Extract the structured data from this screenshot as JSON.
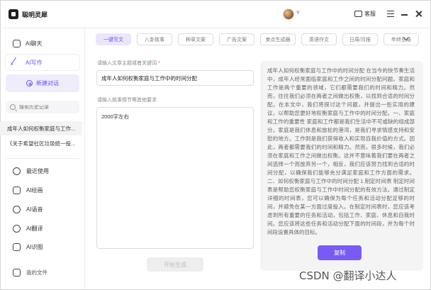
{
  "app": {
    "title": "聪明灵犀",
    "user_name": "Y",
    "service_label": "客服"
  },
  "sidebar": {
    "nav": [
      {
        "label": "AI聊天",
        "icon": "chat-icon"
      },
      {
        "label": "AI写作",
        "icon": "pen-icon"
      }
    ],
    "new_chat_label": "新建对话",
    "search_placeholder": "搜索历史记录",
    "history": [
      "成年人如何权衡家庭与工作...",
      "《关于希望社区垃圾统一投..."
    ],
    "tools": [
      {
        "label": "最近使用",
        "icon": "recent-icon"
      },
      {
        "label": "AI绘画",
        "icon": "paint-icon"
      },
      {
        "label": "AI语音",
        "icon": "voice-icon"
      },
      {
        "label": "AI翻译",
        "icon": "translate-icon"
      },
      {
        "label": "AI识图",
        "icon": "image-recognition-icon"
      }
    ],
    "my_files_label": "我的文件"
  },
  "tabs": [
    "一键写文",
    "八卦故事",
    "种草文案",
    "广告文案",
    "卖点生成器",
    "英语作文",
    "日周/月报",
    "年终总结"
  ],
  "form": {
    "topic_label": "请输入文章主题或者关键词",
    "topic_required_mark": "*",
    "topic_value": "成年人如何权衡家庭与工作中的时间分配",
    "requirements_label": "请输入故事情节等其他要求",
    "requirements_value": "2000字左右",
    "generate_label": "开始生成"
  },
  "output": {
    "text": "成年人如何权衡家庭与工作中的时间分配 在当今的快节奏生活中，成年人经常面临家庭和工作之间的时间分配问题。家庭和工作是两个重要的领域，它们都需要我们的时间和精力。然而，往往我们必须在两者之间做出权衡，以找到合适的时间分配。在本文中，我们将探讨这个问题，并提出一些实用的建议，以帮助您更好地权衡家庭与工作中的时间分配。一、家庭和工作的重要性 家庭和工作都是我们生活中不可或缺的组成部分。家庭是我们休息和放松的港湾，是我们寻求情感支持和安慰的地方。工作则是我们获得收入和实现自我价值的方式。因此，两者都需要我们的时间和精力。然而，很多时候，我们必须在家庭和工作之间做出权衡。这并不意味着我们要在两者之间选择一个而放弃另一个，相反，我们应该努力找到合适的时间分配，以确保我们能够充分满足家庭和工作方面的需求。二、如何权衡家庭与工作中的时间分配 1.制定时间表 制定时间表是帮助您权衡家庭与工作中时间分配的有效方法。通过制定详细的时间表，您可以确保为每个任务和活动分配足够的时间，并避免在某一方面过度投入。在制定时间表时，您应该考虑到所有重要的任务和活动，包括工作、家庭、休息和自我时间。您应该将这些任务和活动分配下面的时间段，并为每个时间段设置具体的目标。",
    "copy_label": "复制"
  },
  "watermark": "CSDN @翻译小达人",
  "colors": {
    "accent": "#6f4df5",
    "accent_light": "#ebe6fd",
    "copy_button": "#7a5af5",
    "panel_bg": "#f4f4f5"
  }
}
